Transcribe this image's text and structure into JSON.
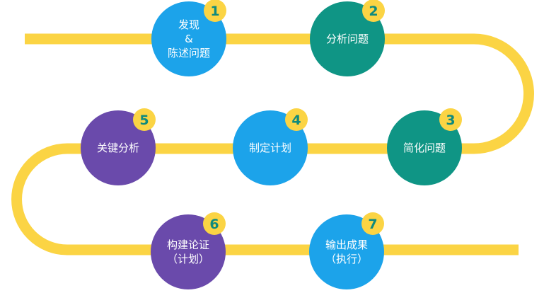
{
  "colors": {
    "track": "#fbd444",
    "badge": "#fbd444",
    "badge_text": "#0f8a7e",
    "node_text": "#ffffff",
    "blue": "#1ca3ea",
    "teal": "#0f9585",
    "purple": "#6a4aab"
  },
  "steps": [
    {
      "number": "1",
      "lines": [
        "发现",
        "&",
        "陈述问题"
      ],
      "color": "blue"
    },
    {
      "number": "2",
      "lines": [
        "分析问题"
      ],
      "color": "teal"
    },
    {
      "number": "3",
      "lines": [
        "简化问题"
      ],
      "color": "teal"
    },
    {
      "number": "4",
      "lines": [
        "制定计划"
      ],
      "color": "blue"
    },
    {
      "number": "5",
      "lines": [
        "关键分析"
      ],
      "color": "purple"
    },
    {
      "number": "6",
      "lines": [
        "构建论证",
        "（计划）"
      ],
      "color": "purple"
    },
    {
      "number": "7",
      "lines": [
        "输出成果",
        "（执行）"
      ],
      "color": "blue"
    }
  ]
}
